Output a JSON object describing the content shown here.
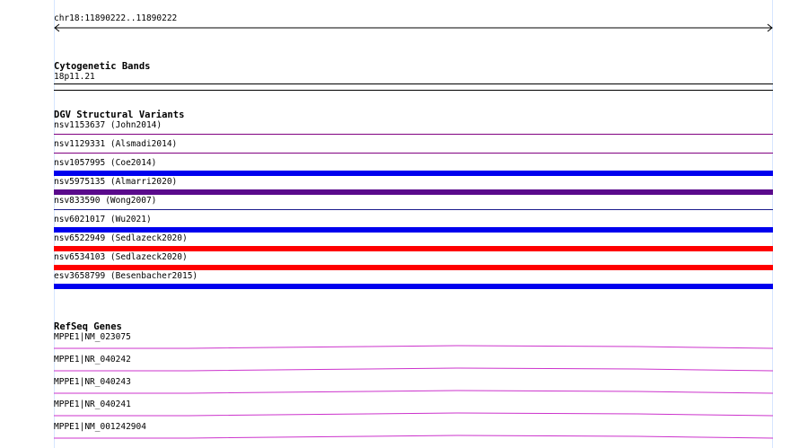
{
  "locus": "chr18:11890222..11890222",
  "cytoband": {
    "title": "Cytogenetic Bands",
    "band": "18p11.21"
  },
  "dgv": {
    "title": "DGV Structural Variants",
    "variants": [
      {
        "label": "nsv1153637 (John2014)",
        "color": "#800080",
        "weight": "thin"
      },
      {
        "label": "nsv1129331 (Alsmadi2014)",
        "color": "#800080",
        "weight": "thin"
      },
      {
        "label": "nsv1057995 (Coe2014)",
        "color": "#0000ee",
        "weight": "thick"
      },
      {
        "label": "nsv5975135 (Almarri2020)",
        "color": "#5a0a8c",
        "weight": "thick"
      },
      {
        "label": "nsv833590 (Wong2007)",
        "color": "#1a1a8c",
        "weight": "thin"
      },
      {
        "label": "nsv6021017 (Wu2021)",
        "color": "#0000ee",
        "weight": "thick"
      },
      {
        "label": "nsv6522949 (Sedlazeck2020)",
        "color": "#ff0000",
        "weight": "thick"
      },
      {
        "label": "nsv6534103 (Sedlazeck2020)",
        "color": "#ff0000",
        "weight": "thick"
      },
      {
        "label": "esv3658799 (Besenbacher2015)",
        "color": "#0000ee",
        "weight": "thick"
      }
    ]
  },
  "refseq": {
    "title": "RefSeq Genes",
    "color": "#cc33cc",
    "genes": [
      {
        "label": "MPPE1|NM_023075"
      },
      {
        "label": "MPPE1|NR_040242"
      },
      {
        "label": "MPPE1|NR_040243"
      },
      {
        "label": "MPPE1|NR_040241"
      },
      {
        "label": "MPPE1|NM_001242904"
      }
    ]
  }
}
